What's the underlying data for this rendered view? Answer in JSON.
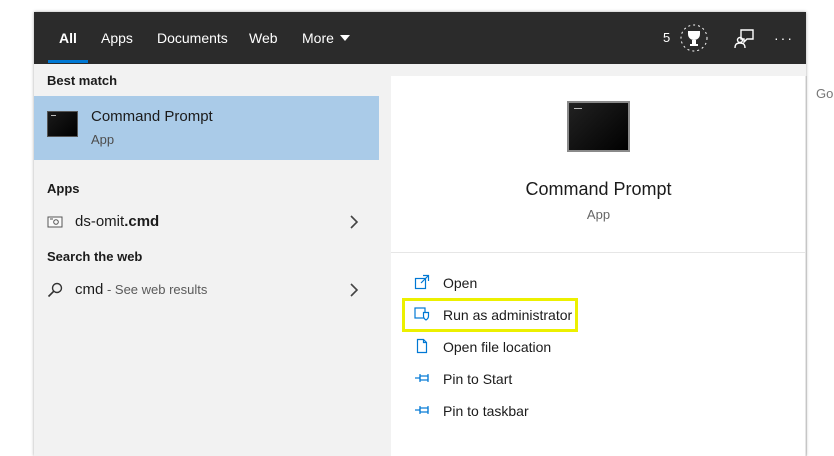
{
  "background": {
    "fragment": "Go"
  },
  "tabs": [
    {
      "label": "All",
      "active": true
    },
    {
      "label": "Apps"
    },
    {
      "label": "Documents"
    },
    {
      "label": "Web"
    },
    {
      "label": "More"
    }
  ],
  "toolbar": {
    "rewards_count": "5",
    "rewards_icon": "trophy-icon",
    "feedback_icon": "feedback-icon",
    "more_options": "···"
  },
  "left": {
    "best_match_label": "Best match",
    "best_match": {
      "title": "Command Prompt",
      "subtitle": "App",
      "icon": "command-prompt-icon"
    },
    "apps_label": "Apps",
    "apps": [
      {
        "name_prefix": "ds-omit",
        "name_bold": ".cmd",
        "icon": "batch-file-icon"
      }
    ],
    "web_label": "Search the web",
    "web": [
      {
        "query": "cmd",
        "hint": " - See web results",
        "icon": "search-icon"
      }
    ]
  },
  "right": {
    "title": "Command Prompt",
    "subtitle": "App",
    "actions": [
      {
        "label": "Open",
        "icon": "open-icon"
      },
      {
        "label": "Run as administrator",
        "icon": "shield-icon",
        "highlighted": true
      },
      {
        "label": "Open file location",
        "icon": "file-icon"
      },
      {
        "label": "Pin to Start",
        "icon": "pin-icon"
      },
      {
        "label": "Pin to taskbar",
        "icon": "pin-icon"
      }
    ]
  },
  "colors": {
    "accent": "#0078d4",
    "selection": "#aacbe8",
    "topbar": "#2b2b2b",
    "highlight_box": "#ecf000",
    "panel": "#f2f2f2"
  }
}
